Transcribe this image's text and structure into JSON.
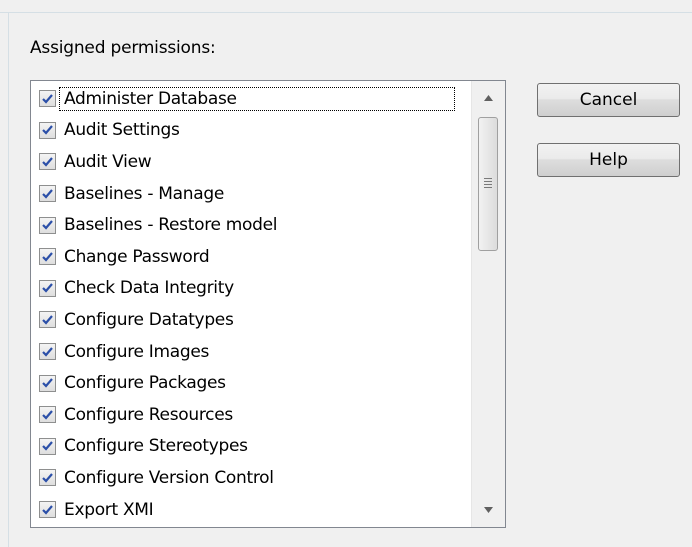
{
  "dialog": {
    "group_label": "Assigned permissions:",
    "cancel_label": "Cancel",
    "help_label": "Help"
  },
  "permissions": [
    {
      "label": "Administer Database",
      "checked": true
    },
    {
      "label": "Audit Settings",
      "checked": true
    },
    {
      "label": "Audit View",
      "checked": true
    },
    {
      "label": "Baselines - Manage",
      "checked": true
    },
    {
      "label": "Baselines - Restore model",
      "checked": true
    },
    {
      "label": "Change Password",
      "checked": true
    },
    {
      "label": "Check Data Integrity",
      "checked": true
    },
    {
      "label": "Configure Datatypes",
      "checked": true
    },
    {
      "label": "Configure Images",
      "checked": true
    },
    {
      "label": "Configure Packages",
      "checked": true
    },
    {
      "label": "Configure Resources",
      "checked": true
    },
    {
      "label": "Configure Stereotypes",
      "checked": true
    },
    {
      "label": "Configure Version Control",
      "checked": true
    },
    {
      "label": "Export XMI",
      "checked": true
    }
  ],
  "colors": {
    "check": "#2b4fa8"
  }
}
